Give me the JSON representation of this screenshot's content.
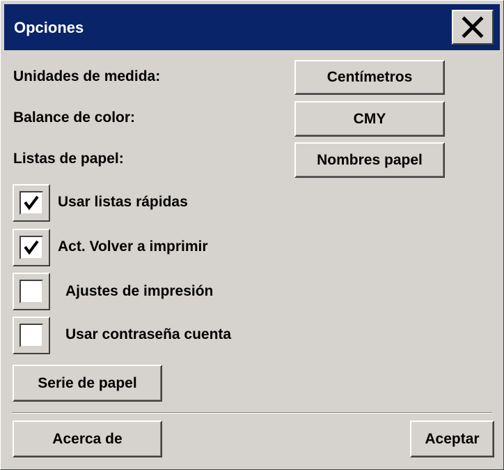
{
  "dialog": {
    "title": "Opciones",
    "close_icon": "close-x-icon"
  },
  "settings": {
    "units_label": "Unidades de medida:",
    "units_value": "Centímetros",
    "color_label": "Balance de color:",
    "color_value": "CMY",
    "paper_lists_label": "Listas de papel:",
    "paper_lists_value": "Nombres papel"
  },
  "checkboxes": [
    {
      "label": "Usar listas rápidas",
      "checked": true
    },
    {
      "label": "Act. Volver a imprimir",
      "checked": true
    },
    {
      "label": "Ajustes de impresión",
      "checked": false
    },
    {
      "label": "Usar contraseña cuenta",
      "checked": false
    }
  ],
  "buttons": {
    "paper_series": "Serie de papel",
    "about": "Acerca de",
    "accept": "Aceptar"
  },
  "colors": {
    "titlebar": "#0a246a",
    "face": "#d6d3ce"
  }
}
